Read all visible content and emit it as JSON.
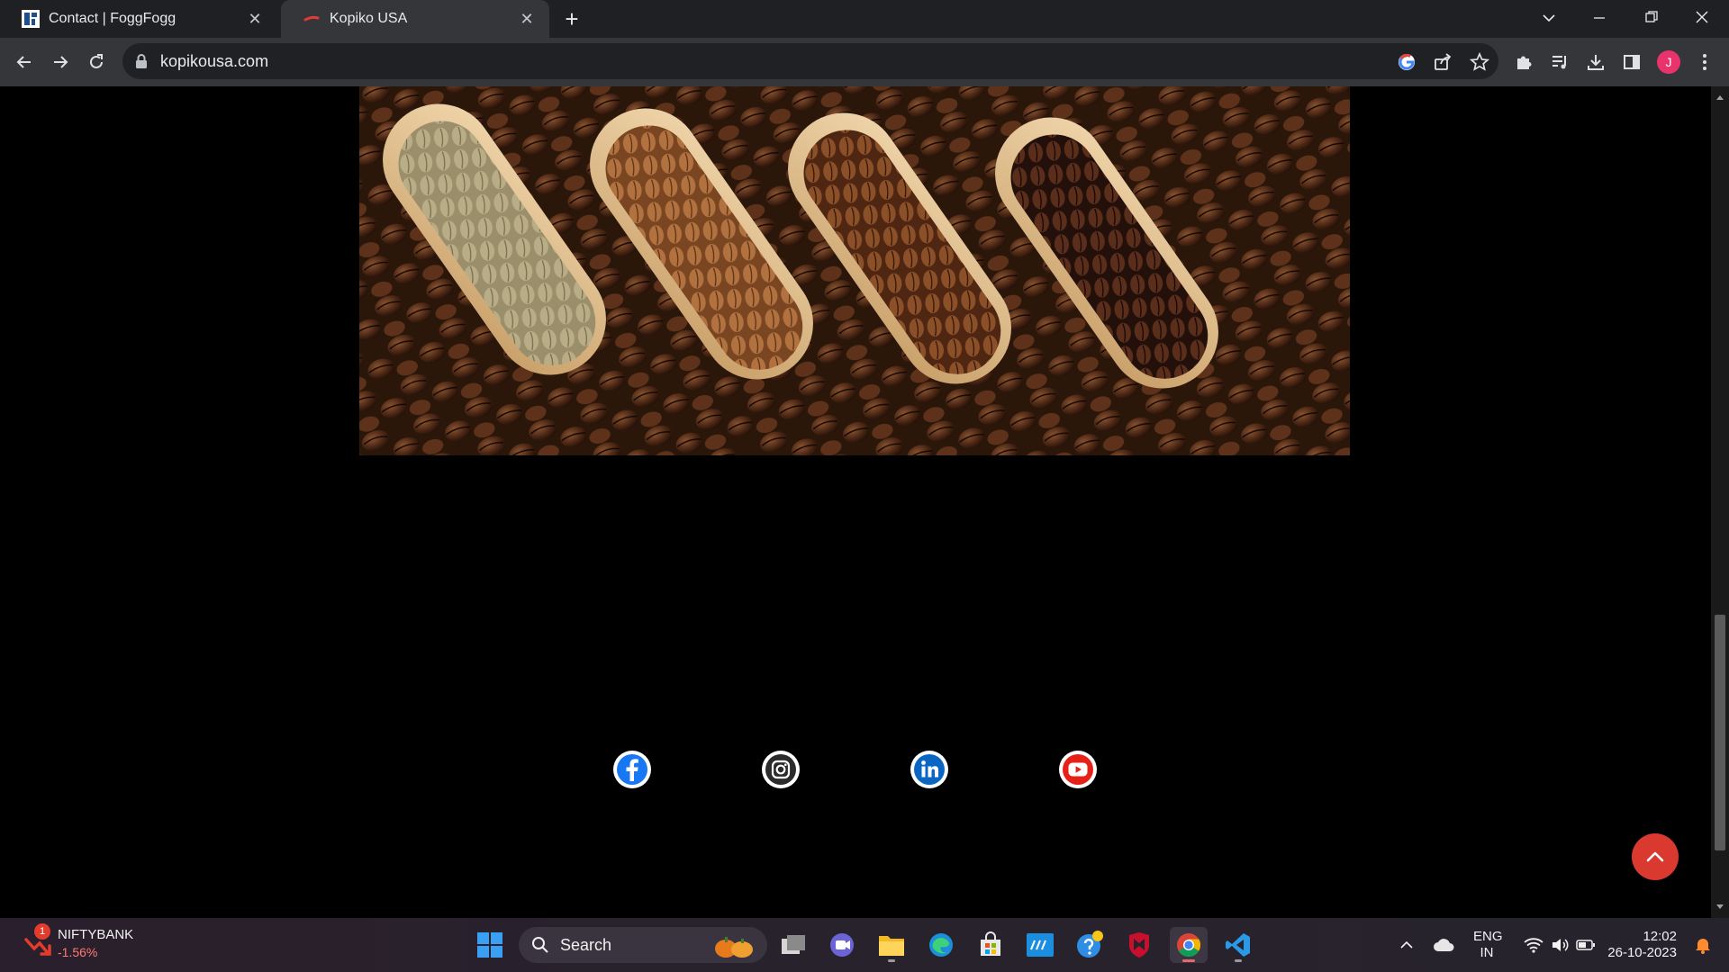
{
  "browser": {
    "tabs": [
      {
        "title": "Contact | FoggFogg",
        "active": false
      },
      {
        "title": "Kopiko USA",
        "active": true
      }
    ],
    "close_glyph": "✕",
    "newtab_glyph": "+",
    "url": "kopikousa.com",
    "profile_initial": "J"
  },
  "page": {
    "hero_image": "coffee-beans-wooden-scoops",
    "social": [
      "facebook-icon",
      "instagram-icon",
      "linkedin-icon",
      "youtube-icon"
    ],
    "colors": {
      "facebook": "#1877f2",
      "instagram": "#2b2b2b",
      "linkedin": "#0a66c2",
      "youtube": "#e62117",
      "back_to_top": "#d9392e"
    }
  },
  "taskbar": {
    "widget_title": "NIFTYBANK",
    "widget_value": "-1.56%",
    "widget_badge": "1",
    "search_label": "Search",
    "lang_top": "ENG",
    "lang_bottom": "IN",
    "time": "12:02",
    "date": "26-10-2023"
  }
}
